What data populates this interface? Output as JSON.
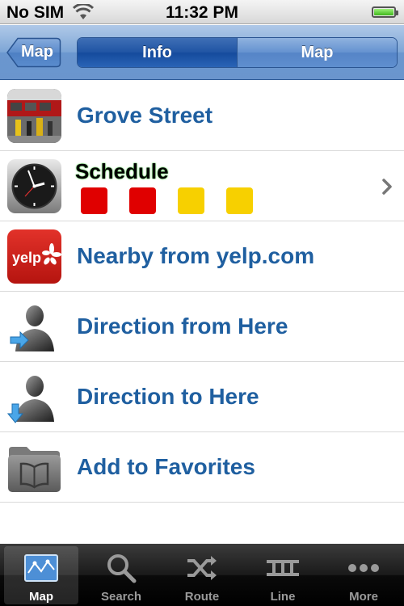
{
  "status_bar": {
    "carrier": "No SIM",
    "time": "11:32 PM",
    "battery_level": 1.0
  },
  "nav_bar": {
    "back_label": "Map",
    "segments": [
      {
        "label": "Info",
        "selected": true
      },
      {
        "label": "Map",
        "selected": false
      }
    ]
  },
  "list": {
    "items": [
      {
        "label": "Grove Street",
        "icon": "station-photo-icon"
      },
      {
        "label": "Schedule",
        "icon": "clock-icon",
        "squares": [
          "#e00000",
          "#e00000",
          "#f7d000",
          "#f7d000"
        ]
      },
      {
        "label": "Nearby from yelp.com",
        "icon": "yelp-icon",
        "icon_text": "yelp"
      },
      {
        "label": "Direction from Here",
        "icon": "person-arrow-right-icon"
      },
      {
        "label": "Direction to Here",
        "icon": "person-arrow-down-icon"
      },
      {
        "label": "Add to Favorites",
        "icon": "folder-book-icon"
      }
    ]
  },
  "tab_bar": {
    "tabs": [
      {
        "label": "Map",
        "icon": "map-icon",
        "selected": true
      },
      {
        "label": "Search",
        "icon": "search-icon",
        "selected": false
      },
      {
        "label": "Route",
        "icon": "shuffle-icon",
        "selected": false
      },
      {
        "label": "Line",
        "icon": "track-icon",
        "selected": false
      },
      {
        "label": "More",
        "icon": "more-icon",
        "selected": false
      }
    ]
  },
  "colors": {
    "accent": "#1f5fa0",
    "nav": "#6a95cd"
  }
}
